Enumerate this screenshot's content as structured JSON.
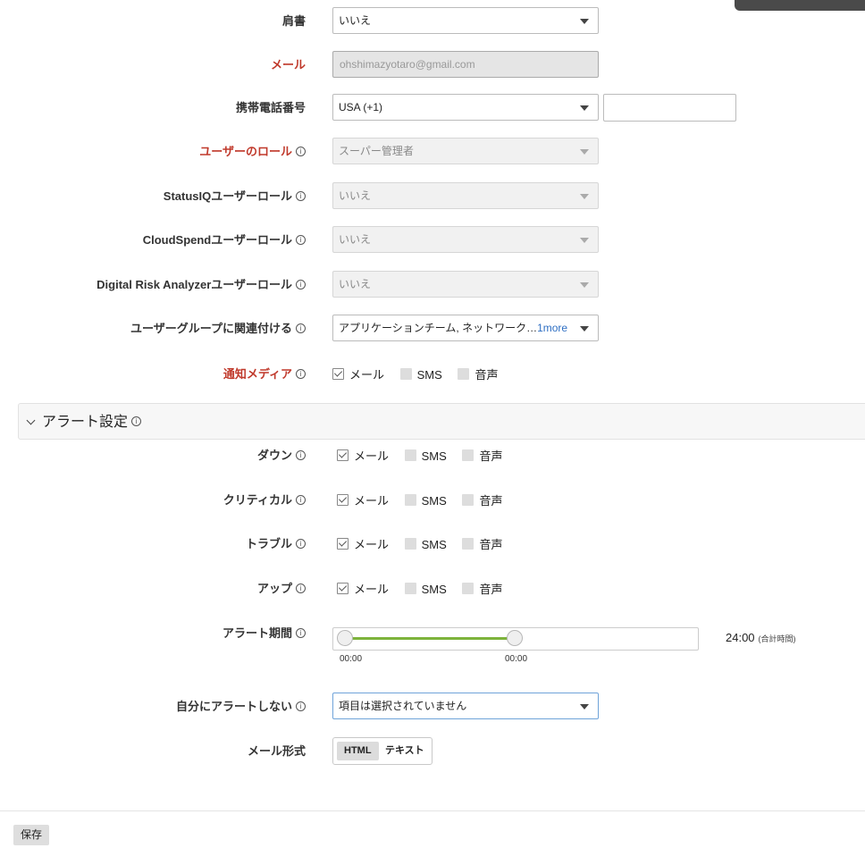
{
  "fields": {
    "title": {
      "label": "肩書",
      "value": "いいえ"
    },
    "email": {
      "label": "メール",
      "value": "ohshimazyotaro@gmail.com"
    },
    "mobile": {
      "label": "携帯電話番号",
      "country": "USA (+1)",
      "number": ""
    },
    "user_role": {
      "label": "ユーザーのロール",
      "value": "スーパー管理者"
    },
    "statusiq_role": {
      "label": "StatusIQユーザーロール",
      "value": "いいえ"
    },
    "cloudspend_role": {
      "label": "CloudSpendユーザーロール",
      "value": "いいえ"
    },
    "dra_role": {
      "label": "Digital Risk Analyzerユーザーロール",
      "value": "いいえ"
    },
    "user_groups": {
      "label": "ユーザーグループに関連付ける",
      "value": "アプリケーションチーム, ネットワーク…",
      "more": "1more"
    },
    "notify_media": {
      "label": "通知メディア"
    }
  },
  "media_options": {
    "mail": "メール",
    "sms": "SMS",
    "voice": "音声"
  },
  "alert_section": {
    "title": "アラート設定",
    "rows": [
      {
        "label": "ダウン",
        "mail": true,
        "sms": false,
        "voice": false
      },
      {
        "label": "クリティカル",
        "mail": true,
        "sms": false,
        "voice": false
      },
      {
        "label": "トラブル",
        "mail": true,
        "sms": false,
        "voice": false
      },
      {
        "label": "アップ",
        "mail": true,
        "sms": false,
        "voice": false
      }
    ],
    "period": {
      "label": "アラート期間",
      "start": "00:00",
      "end": "00:00",
      "total": "24:00",
      "total_note": "(合計時間)"
    },
    "no_self_alert": {
      "label": "自分にアラートしない",
      "value": "項目は選択されていません"
    },
    "mail_format": {
      "label": "メール形式",
      "options": [
        "HTML",
        "テキスト"
      ],
      "selected": "HTML"
    }
  },
  "footer": {
    "save": "保存"
  },
  "colors": {
    "required": "#c0392b",
    "slider": "#7db33c",
    "link": "#2f6fc3"
  },
  "info_glyph": "i"
}
